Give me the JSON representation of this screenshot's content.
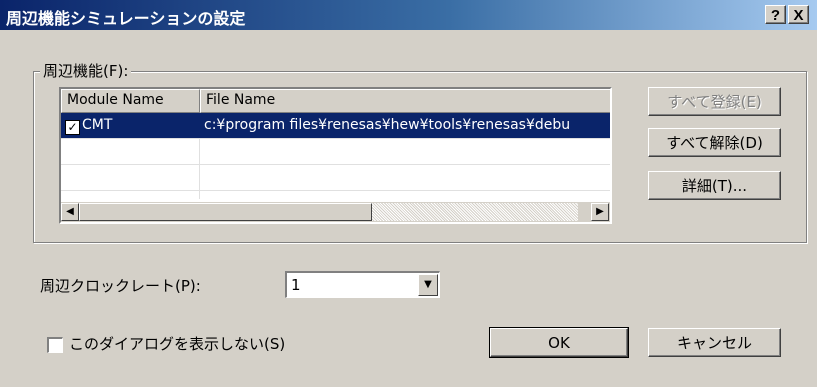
{
  "window": {
    "title": "周辺機能シミュレーションの設定",
    "help_label": "?",
    "close_label": "X"
  },
  "peripheral_group": {
    "label": "周辺機能(F):",
    "columns": [
      "Module Name",
      "File Name"
    ],
    "rows": [
      {
        "checked": true,
        "check_mark": "✓",
        "module": "CMT",
        "file": "c:¥program files¥renesas¥hew¥tools¥renesas¥debu"
      }
    ],
    "scroll_left_icon": "◀",
    "scroll_right_icon": "▶"
  },
  "buttons": {
    "register_all": "すべて登録(E)",
    "release_all": "すべて解除(D)",
    "details": "詳細(T)...",
    "ok": "OK",
    "cancel": "キャンセル"
  },
  "clock": {
    "label": "周辺クロックレート(P):",
    "value": "1",
    "dropdown_icon": "▼"
  },
  "dont_show": {
    "label": "このダイアログを表示しない(S)",
    "checked": false
  },
  "colors": {
    "face": "#d4d0c8",
    "title_start": "#0a246a",
    "title_end": "#a6caf0",
    "selection": "#0a246a"
  }
}
